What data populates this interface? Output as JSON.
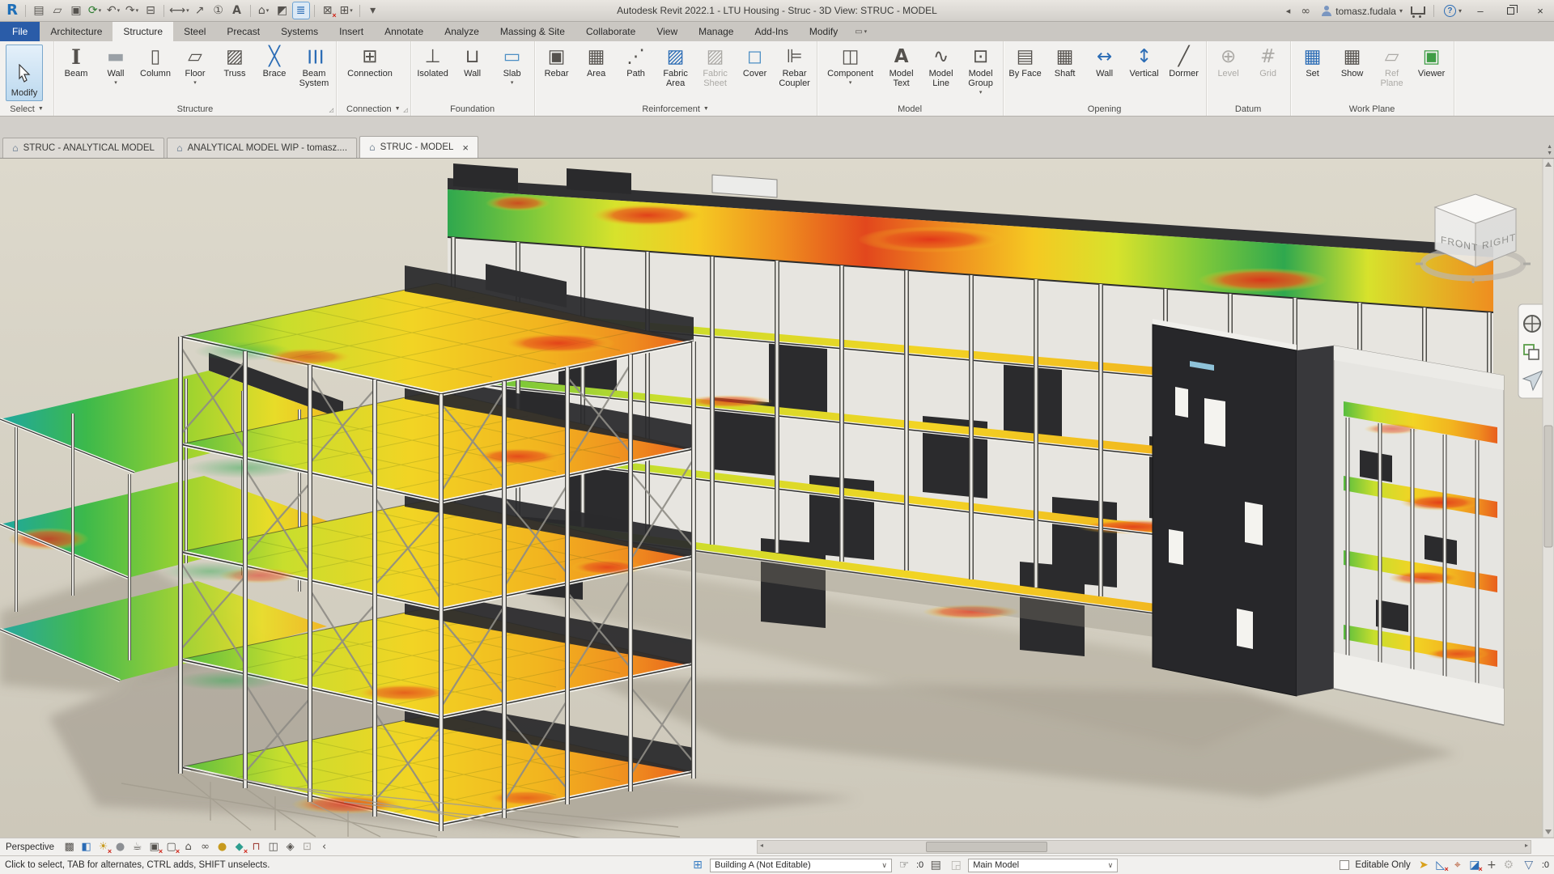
{
  "colors": {
    "accent_blue": "#2b6cb5",
    "file_tab_blue": "#2a5ca8",
    "modify_highlight": "#bcd9ef",
    "canvas_background": "#d6d1c3",
    "heat_green": "#2fa84e",
    "heat_yellow": "#f2d424",
    "heat_orange": "#ef8d1f",
    "heat_red": "#e2471d",
    "dark_wall": "#2b2b2d"
  },
  "title_bar": {
    "title": "Autodesk Revit 2022.1 - LTU Housing - Struc - 3D View: STRUC - MODEL",
    "user": "tomasz.fudala",
    "qat": [
      {
        "name": "revit-logo-icon",
        "glyph": "R",
        "cls": "logo"
      },
      {
        "sep": true
      },
      {
        "name": "properties-icon",
        "glyph": "▤"
      },
      {
        "name": "open-icon",
        "glyph": "▱"
      },
      {
        "name": "save-icon",
        "glyph": "▣"
      },
      {
        "name": "sync-with-central-icon",
        "glyph": "⟳",
        "color": "#2f7d32",
        "drop": true
      },
      {
        "name": "undo-icon",
        "glyph": "↶",
        "drop": true
      },
      {
        "name": "redo-icon",
        "glyph": "↷",
        "drop": true
      },
      {
        "name": "print-icon",
        "glyph": "⊟"
      },
      {
        "sep": true
      },
      {
        "name": "measure-icon",
        "glyph": "⟷",
        "drop": true
      },
      {
        "name": "aligned-dimension-icon",
        "glyph": "↗"
      },
      {
        "name": "tag-by-category-icon",
        "glyph": "①"
      },
      {
        "name": "text-icon",
        "glyph": "A",
        "cls": "bold"
      },
      {
        "sep": true
      },
      {
        "name": "default-3d-view-icon",
        "glyph": "⌂",
        "drop": true
      },
      {
        "name": "section-icon",
        "glyph": "◩"
      },
      {
        "name": "thin-lines-icon",
        "glyph": "≣",
        "active": true,
        "color": "#2b6cb5"
      },
      {
        "sep": true
      },
      {
        "name": "close-inactive-windows-icon",
        "glyph": "⊠",
        "overlay": "×"
      },
      {
        "name": "switch-windows-icon",
        "glyph": "⊞",
        "drop": true
      },
      {
        "sep": true
      },
      {
        "name": "customize-qat-icon",
        "glyph": "▾"
      }
    ]
  },
  "ribbon": {
    "active_tab": "Structure",
    "tabs": [
      "File",
      "Architecture",
      "Structure",
      "Steel",
      "Precast",
      "Systems",
      "Insert",
      "Annotate",
      "Analyze",
      "Massing & Site",
      "Collaborate",
      "View",
      "Manage",
      "Add-Ins",
      "Modify"
    ],
    "modify_label": "Modify",
    "panels": [
      {
        "caption": "Select",
        "buttons": []
      },
      {
        "caption": "Structure",
        "buttons": [
          {
            "name": "beam-button",
            "label": "Beam",
            "glyph": "I",
            "cls": "serif"
          },
          {
            "name": "wall-button",
            "label": "Wall",
            "glyph": "▬",
            "color": "#9aa0a6",
            "drop": true
          },
          {
            "name": "column-button",
            "label": "Column",
            "glyph": "▯"
          },
          {
            "name": "floor-button",
            "label": "Floor",
            "glyph": "▱",
            "drop": true
          },
          {
            "name": "truss-button",
            "label": "Truss",
            "glyph": "▨"
          },
          {
            "name": "brace-button",
            "label": "Brace",
            "glyph": "╳",
            "color": "#2b6cb5"
          },
          {
            "name": "beam-system-button",
            "label": "Beam System",
            "glyph": "☰",
            "cls": "rot90",
            "color": "#2b6cb5"
          }
        ]
      },
      {
        "caption": "Connection",
        "buttons": [
          {
            "name": "connection-button",
            "label": "Connection",
            "glyph": "⊞",
            "wide": true
          }
        ]
      },
      {
        "caption": "Foundation",
        "buttons": [
          {
            "name": "isolated-button",
            "label": "Isolated",
            "glyph": "⊥"
          },
          {
            "name": "wall-foundation-button",
            "label": "Wall",
            "glyph": "⊔"
          },
          {
            "name": "slab-button",
            "label": "Slab",
            "glyph": "▭",
            "color": "#4d8fc4",
            "drop": true
          }
        ]
      },
      {
        "caption": "Reinforcement",
        "buttons": [
          {
            "name": "rebar-button",
            "label": "Rebar",
            "glyph": "▣"
          },
          {
            "name": "area-button",
            "label": "Area",
            "glyph": "▦"
          },
          {
            "name": "path-button",
            "label": "Path",
            "glyph": "⋰"
          },
          {
            "name": "fabric-area-button",
            "label": "Fabric Area",
            "glyph": "▨",
            "color": "#2b6cb5"
          },
          {
            "name": "fabric-sheet-button",
            "label": "Fabric Sheet",
            "glyph": "▨",
            "disabled": true
          },
          {
            "name": "cover-button",
            "label": "Cover",
            "glyph": "◻",
            "color": "#4d8fc4"
          },
          {
            "name": "rebar-coupler-button",
            "label": "Rebar Coupler",
            "glyph": "⊫"
          }
        ]
      },
      {
        "caption": "Model",
        "buttons": [
          {
            "name": "component-button",
            "label": "Component",
            "glyph": "◫",
            "drop": true,
            "wide": true
          },
          {
            "name": "model-text-button",
            "label": "Model Text",
            "glyph": "A",
            "cls": "bold"
          },
          {
            "name": "model-line-button",
            "label": "Model Line",
            "glyph": "∿"
          },
          {
            "name": "model-group-button",
            "label": "Model Group",
            "glyph": "⊡",
            "drop": true
          }
        ]
      },
      {
        "caption": "Opening",
        "buttons": [
          {
            "name": "by-face-button",
            "label": "By Face",
            "glyph": "▤"
          },
          {
            "name": "shaft-button",
            "label": "Shaft",
            "glyph": "▦"
          },
          {
            "name": "wall-opening-button",
            "label": "Wall",
            "glyph": "↔",
            "color": "#2b6cb5"
          },
          {
            "name": "vertical-opening-button",
            "label": "Vertical",
            "glyph": "↕",
            "color": "#2b6cb5"
          },
          {
            "name": "dormer-button",
            "label": "Dormer",
            "glyph": "╱"
          }
        ]
      },
      {
        "caption": "Datum",
        "buttons": [
          {
            "name": "level-button",
            "label": "Level",
            "glyph": "⊕",
            "disabled": true
          },
          {
            "name": "grid-button",
            "label": "Grid",
            "glyph": "#",
            "disabled": true
          }
        ]
      },
      {
        "caption": "Work Plane",
        "buttons": [
          {
            "name": "set-work-plane-button",
            "label": "Set",
            "glyph": "▦",
            "color": "#2b6cb5"
          },
          {
            "name": "show-work-plane-button",
            "label": "Show",
            "glyph": "▦"
          },
          {
            "name": "ref-plane-button",
            "label": "Ref Plane",
            "glyph": "▱",
            "disabled": true
          },
          {
            "name": "viewer-button",
            "label": "Viewer",
            "glyph": "▣",
            "color": "#3f9d46"
          }
        ]
      }
    ]
  },
  "view_tabs": [
    {
      "label": "STRUC - ANALYTICAL MODEL"
    },
    {
      "label": "ANALYTICAL MODEL WIP - tomasz...."
    },
    {
      "label": "STRUC - MODEL",
      "active": true
    }
  ],
  "canvas": {
    "viewcube": {
      "front_label": "FRONT",
      "right_label": "RIGHT"
    }
  },
  "view_control_bar": {
    "label": "Perspective",
    "icons": [
      {
        "name": "view-scale-icon",
        "glyph": "▩"
      },
      {
        "name": "visual-style-icon",
        "glyph": "◧",
        "color": "#2b6cb5"
      },
      {
        "name": "sun-path-icon",
        "glyph": "☀",
        "color": "#c79a1e",
        "overlay": "×"
      },
      {
        "name": "shadows-icon",
        "glyph": "●",
        "color": "#8d9094"
      },
      {
        "name": "show-rendering-icon",
        "glyph": "☕"
      },
      {
        "name": "crop-view-icon",
        "glyph": "▣",
        "overlay": "×"
      },
      {
        "name": "crop-region-icon",
        "glyph": "▢",
        "overlay": "×"
      },
      {
        "name": "unlocked-view-icon",
        "glyph": "⌂"
      },
      {
        "name": "temporary-view-properties-icon",
        "glyph": "∞"
      },
      {
        "name": "reveal-hidden-elements-icon",
        "glyph": "●",
        "color": "#c79a1e"
      },
      {
        "name": "analytical-model-icon",
        "glyph": "◆",
        "color": "#2e9e8f",
        "overlay": "×"
      },
      {
        "name": "reveal-constraints-icon",
        "glyph": "⊓",
        "color": "#a04038"
      },
      {
        "name": "worksharing-display-icon",
        "glyph": "◫"
      },
      {
        "name": "displaced-elements-icon",
        "glyph": "◈"
      },
      {
        "name": "selection-lock-icon",
        "glyph": "⊡",
        "color": "#a5a29c"
      },
      {
        "name": "collapse-bar-icon",
        "glyph": "‹"
      }
    ]
  },
  "status_bar": {
    "hint": "Click to select, TAB for alternates, CTRL adds, SHIFT unselects.",
    "workset_dropdown_value": "Building A (Not Editable)",
    "editable_requests_count": ":0",
    "design_option_dropdown_value": "Main Model",
    "editable_only_label": "Editable Only",
    "filter_count": ":0",
    "right_icons": [
      {
        "name": "select-links-icon",
        "glyph": "➤",
        "color": "#d9a11c"
      },
      {
        "name": "select-underlay-icon",
        "glyph": "◺",
        "color": "#2b6cb5",
        "overlay": "×"
      },
      {
        "name": "select-pinned-icon",
        "glyph": "⌖",
        "color": "#b3542e"
      },
      {
        "name": "select-by-face-icon",
        "glyph": "◪",
        "color": "#2b6cb5",
        "overlay": "×"
      },
      {
        "name": "drag-on-selection-icon",
        "glyph": "+",
        "color": "#55524e"
      },
      {
        "name": "background-processes-icon",
        "glyph": "⚙",
        "color": "#b8b6b2"
      }
    ]
  }
}
